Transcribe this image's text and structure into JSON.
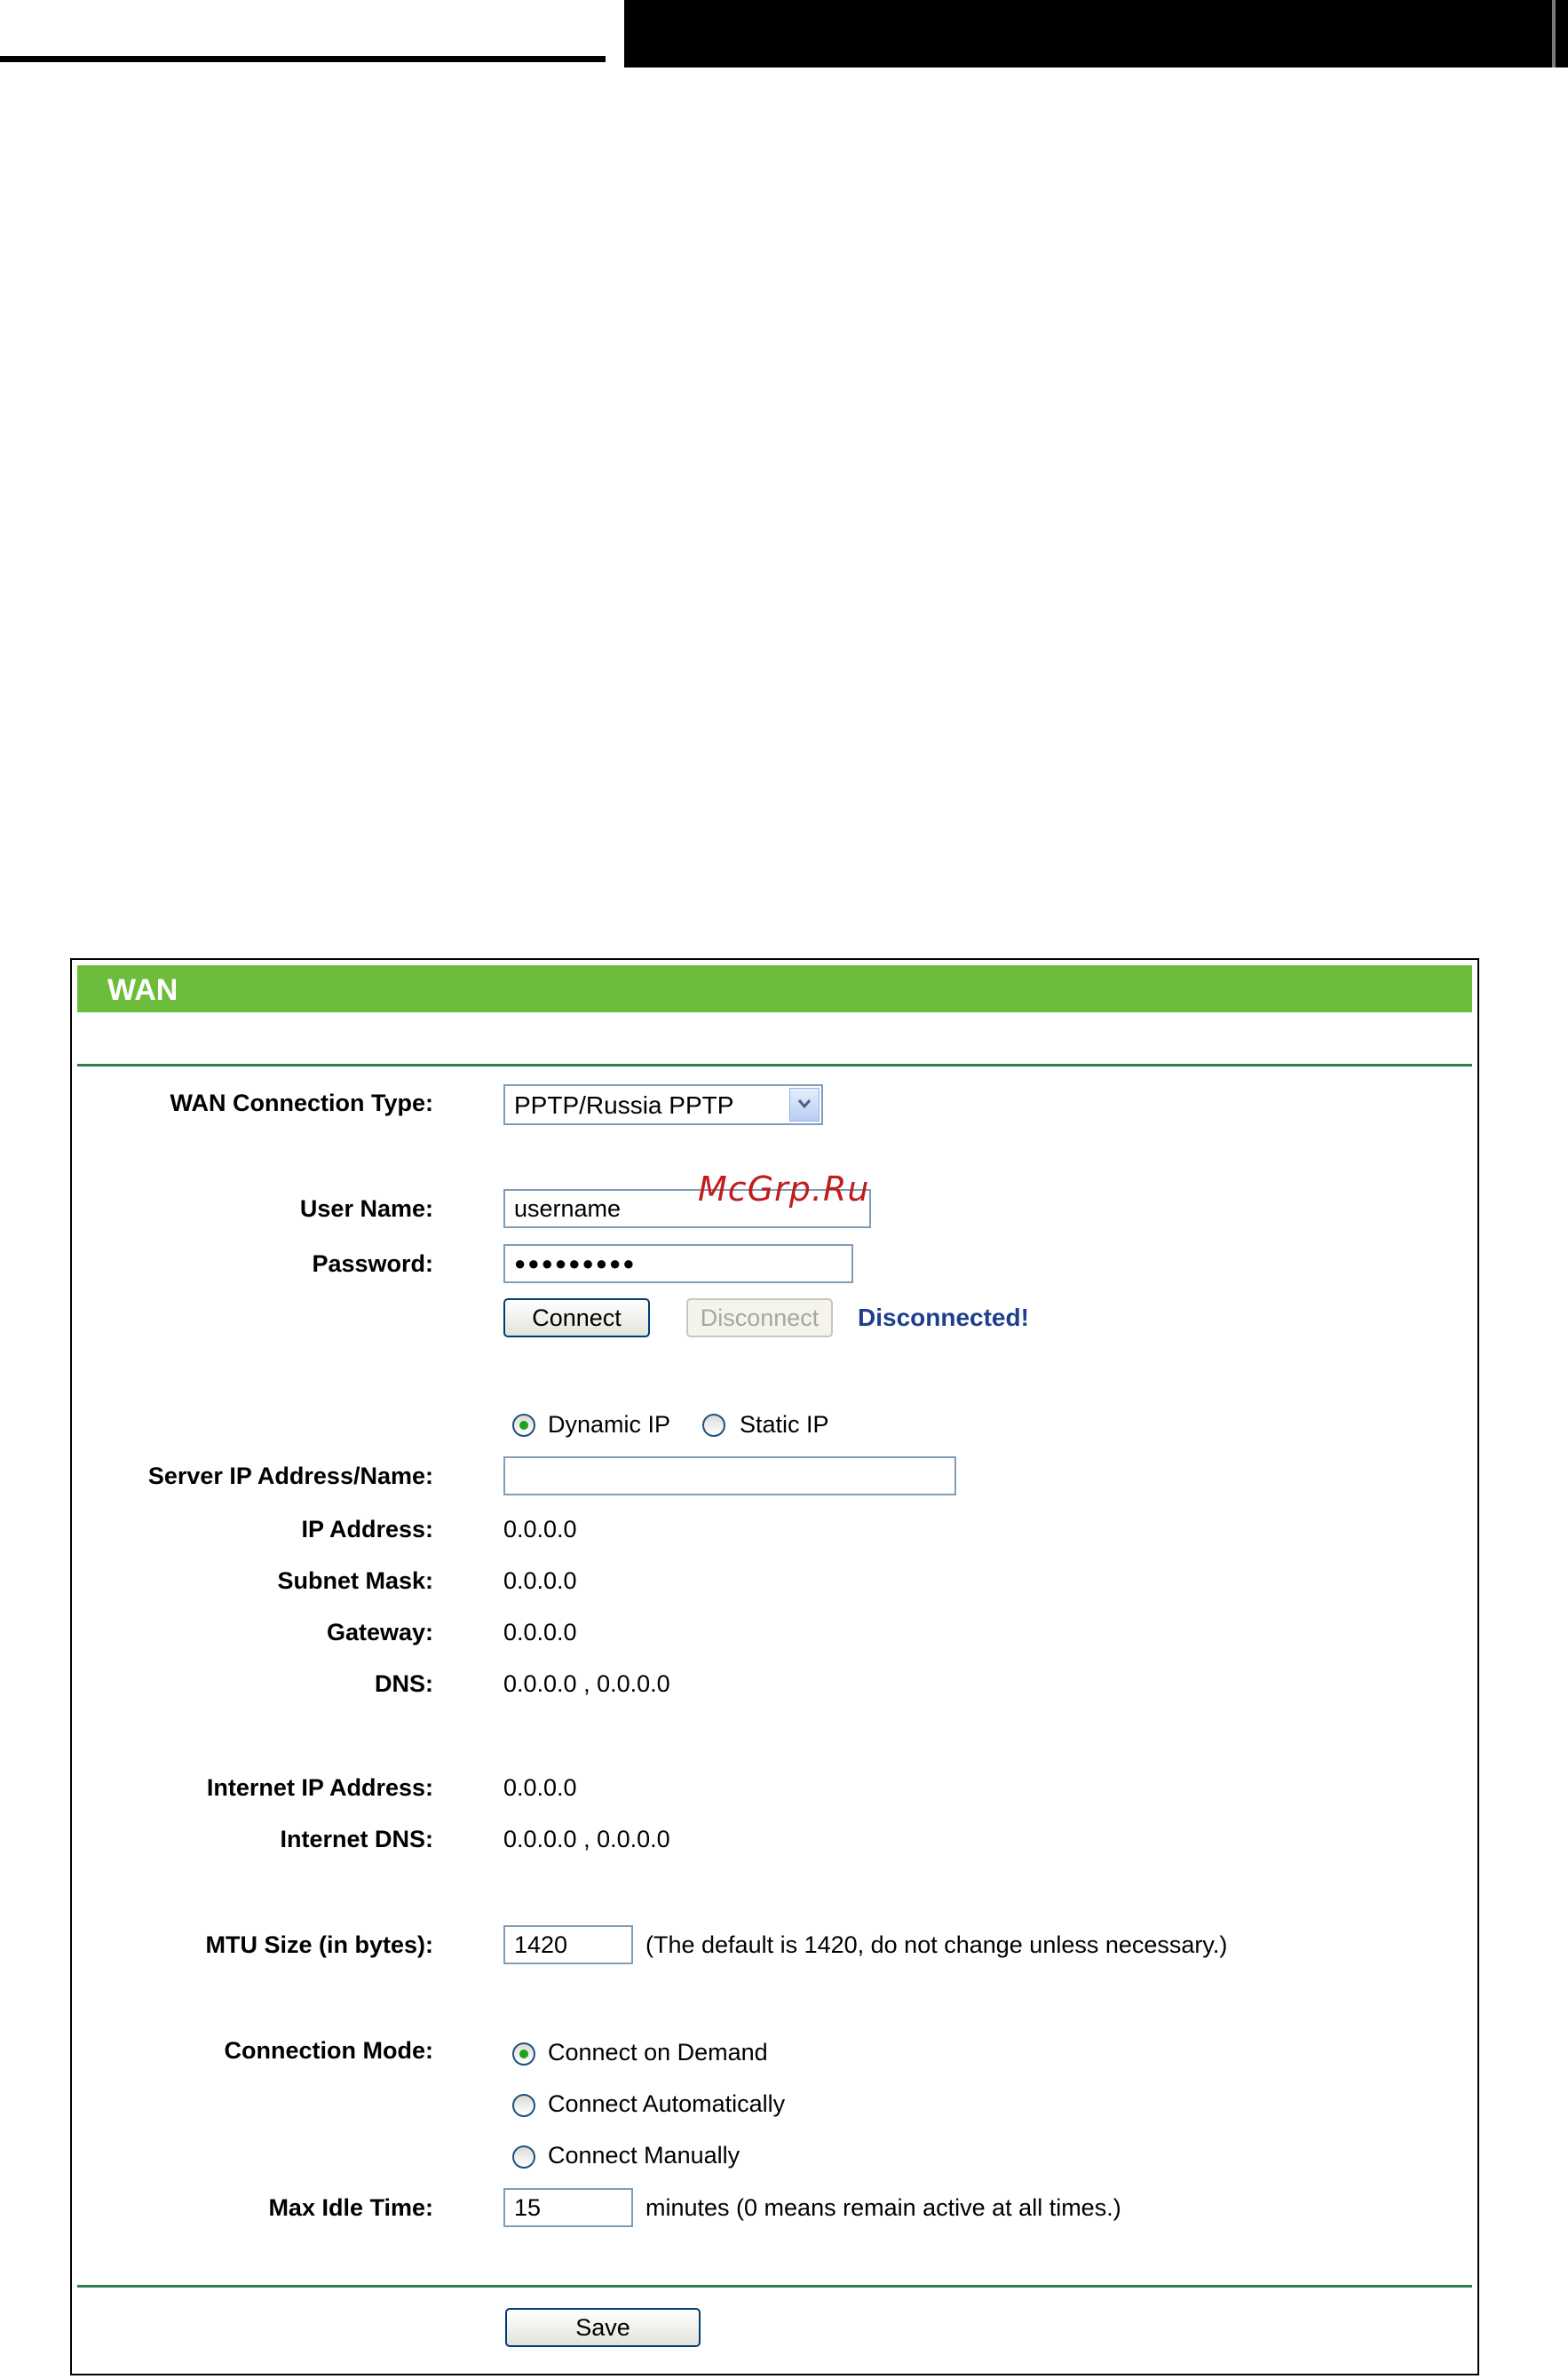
{
  "watermark": "McGrp.Ru",
  "panel": {
    "title": "WAN"
  },
  "wan_type": {
    "label": "WAN Connection Type:",
    "selected": "PPTP/Russia PPTP"
  },
  "user_name": {
    "label": "User Name:",
    "value": "username"
  },
  "password": {
    "label": "Password:",
    "masked": "●●●●●●●●●"
  },
  "buttons": {
    "connect": "Connect",
    "disconnect": "Disconnect",
    "save": "Save"
  },
  "status": "Disconnected!",
  "ip_mode": {
    "dynamic": "Dynamic IP",
    "static": "Static IP",
    "selected": "dynamic"
  },
  "server": {
    "label": "Server IP Address/Name:",
    "value": ""
  },
  "info": {
    "ip_label": "IP Address:",
    "ip": "0.0.0.0",
    "mask_label": "Subnet Mask:",
    "mask": "0.0.0.0",
    "gateway_label": "Gateway:",
    "gateway": "0.0.0.0",
    "dns_label": "DNS:",
    "dns": "0.0.0.0 , 0.0.0.0",
    "inet_ip_label": "Internet IP Address:",
    "inet_ip": "0.0.0.0",
    "inet_dns_label": "Internet DNS:",
    "inet_dns": "0.0.0.0 , 0.0.0.0"
  },
  "mtu": {
    "label": "MTU Size (in bytes):",
    "value": "1420",
    "hint": "(The default is 1420, do not change unless necessary.)"
  },
  "mode": {
    "label": "Connection Mode:",
    "on_demand": "Connect on Demand",
    "automatic": "Connect Automatically",
    "manual": "Connect Manually",
    "selected": "on_demand"
  },
  "idle": {
    "label": "Max Idle Time:",
    "value": "15",
    "hint": "minutes (0 means remain active at all times.)"
  }
}
